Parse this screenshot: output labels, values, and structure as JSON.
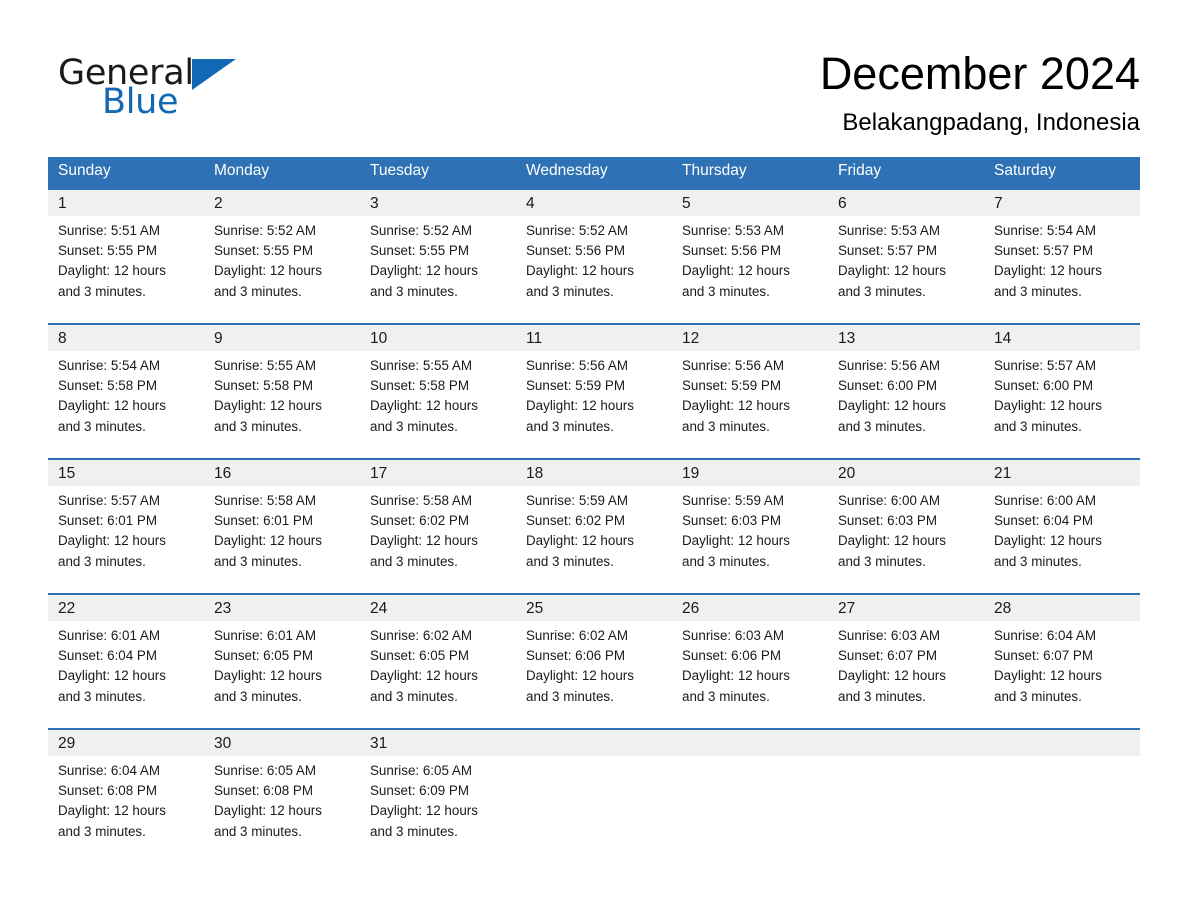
{
  "brand": {
    "name_part1": "General",
    "name_part2": "Blue",
    "triangle_icon": "blue-triangle-logo-mark",
    "accent_color": "#1268b3"
  },
  "header": {
    "title": "December 2024",
    "subtitle": "Belakangpadang, Indonesia"
  },
  "theme": {
    "header_blue": "#2E71B4",
    "daynum_band": "#f0f0f0",
    "text": "#1a1a1a"
  },
  "calendar": {
    "day_headers": [
      "Sunday",
      "Monday",
      "Tuesday",
      "Wednesday",
      "Thursday",
      "Friday",
      "Saturday"
    ],
    "weeks": [
      {
        "days": [
          {
            "num": "1",
            "sunrise": "Sunrise: 5:51 AM",
            "sunset": "Sunset: 5:55 PM",
            "daylight1": "Daylight: 12 hours",
            "daylight2": "and 3 minutes."
          },
          {
            "num": "2",
            "sunrise": "Sunrise: 5:52 AM",
            "sunset": "Sunset: 5:55 PM",
            "daylight1": "Daylight: 12 hours",
            "daylight2": "and 3 minutes."
          },
          {
            "num": "3",
            "sunrise": "Sunrise: 5:52 AM",
            "sunset": "Sunset: 5:55 PM",
            "daylight1": "Daylight: 12 hours",
            "daylight2": "and 3 minutes."
          },
          {
            "num": "4",
            "sunrise": "Sunrise: 5:52 AM",
            "sunset": "Sunset: 5:56 PM",
            "daylight1": "Daylight: 12 hours",
            "daylight2": "and 3 minutes."
          },
          {
            "num": "5",
            "sunrise": "Sunrise: 5:53 AM",
            "sunset": "Sunset: 5:56 PM",
            "daylight1": "Daylight: 12 hours",
            "daylight2": "and 3 minutes."
          },
          {
            "num": "6",
            "sunrise": "Sunrise: 5:53 AM",
            "sunset": "Sunset: 5:57 PM",
            "daylight1": "Daylight: 12 hours",
            "daylight2": "and 3 minutes."
          },
          {
            "num": "7",
            "sunrise": "Sunrise: 5:54 AM",
            "sunset": "Sunset: 5:57 PM",
            "daylight1": "Daylight: 12 hours",
            "daylight2": "and 3 minutes."
          }
        ]
      },
      {
        "days": [
          {
            "num": "8",
            "sunrise": "Sunrise: 5:54 AM",
            "sunset": "Sunset: 5:58 PM",
            "daylight1": "Daylight: 12 hours",
            "daylight2": "and 3 minutes."
          },
          {
            "num": "9",
            "sunrise": "Sunrise: 5:55 AM",
            "sunset": "Sunset: 5:58 PM",
            "daylight1": "Daylight: 12 hours",
            "daylight2": "and 3 minutes."
          },
          {
            "num": "10",
            "sunrise": "Sunrise: 5:55 AM",
            "sunset": "Sunset: 5:58 PM",
            "daylight1": "Daylight: 12 hours",
            "daylight2": "and 3 minutes."
          },
          {
            "num": "11",
            "sunrise": "Sunrise: 5:56 AM",
            "sunset": "Sunset: 5:59 PM",
            "daylight1": "Daylight: 12 hours",
            "daylight2": "and 3 minutes."
          },
          {
            "num": "12",
            "sunrise": "Sunrise: 5:56 AM",
            "sunset": "Sunset: 5:59 PM",
            "daylight1": "Daylight: 12 hours",
            "daylight2": "and 3 minutes."
          },
          {
            "num": "13",
            "sunrise": "Sunrise: 5:56 AM",
            "sunset": "Sunset: 6:00 PM",
            "daylight1": "Daylight: 12 hours",
            "daylight2": "and 3 minutes."
          },
          {
            "num": "14",
            "sunrise": "Sunrise: 5:57 AM",
            "sunset": "Sunset: 6:00 PM",
            "daylight1": "Daylight: 12 hours",
            "daylight2": "and 3 minutes."
          }
        ]
      },
      {
        "days": [
          {
            "num": "15",
            "sunrise": "Sunrise: 5:57 AM",
            "sunset": "Sunset: 6:01 PM",
            "daylight1": "Daylight: 12 hours",
            "daylight2": "and 3 minutes."
          },
          {
            "num": "16",
            "sunrise": "Sunrise: 5:58 AM",
            "sunset": "Sunset: 6:01 PM",
            "daylight1": "Daylight: 12 hours",
            "daylight2": "and 3 minutes."
          },
          {
            "num": "17",
            "sunrise": "Sunrise: 5:58 AM",
            "sunset": "Sunset: 6:02 PM",
            "daylight1": "Daylight: 12 hours",
            "daylight2": "and 3 minutes."
          },
          {
            "num": "18",
            "sunrise": "Sunrise: 5:59 AM",
            "sunset": "Sunset: 6:02 PM",
            "daylight1": "Daylight: 12 hours",
            "daylight2": "and 3 minutes."
          },
          {
            "num": "19",
            "sunrise": "Sunrise: 5:59 AM",
            "sunset": "Sunset: 6:03 PM",
            "daylight1": "Daylight: 12 hours",
            "daylight2": "and 3 minutes."
          },
          {
            "num": "20",
            "sunrise": "Sunrise: 6:00 AM",
            "sunset": "Sunset: 6:03 PM",
            "daylight1": "Daylight: 12 hours",
            "daylight2": "and 3 minutes."
          },
          {
            "num": "21",
            "sunrise": "Sunrise: 6:00 AM",
            "sunset": "Sunset: 6:04 PM",
            "daylight1": "Daylight: 12 hours",
            "daylight2": "and 3 minutes."
          }
        ]
      },
      {
        "days": [
          {
            "num": "22",
            "sunrise": "Sunrise: 6:01 AM",
            "sunset": "Sunset: 6:04 PM",
            "daylight1": "Daylight: 12 hours",
            "daylight2": "and 3 minutes."
          },
          {
            "num": "23",
            "sunrise": "Sunrise: 6:01 AM",
            "sunset": "Sunset: 6:05 PM",
            "daylight1": "Daylight: 12 hours",
            "daylight2": "and 3 minutes."
          },
          {
            "num": "24",
            "sunrise": "Sunrise: 6:02 AM",
            "sunset": "Sunset: 6:05 PM",
            "daylight1": "Daylight: 12 hours",
            "daylight2": "and 3 minutes."
          },
          {
            "num": "25",
            "sunrise": "Sunrise: 6:02 AM",
            "sunset": "Sunset: 6:06 PM",
            "daylight1": "Daylight: 12 hours",
            "daylight2": "and 3 minutes."
          },
          {
            "num": "26",
            "sunrise": "Sunrise: 6:03 AM",
            "sunset": "Sunset: 6:06 PM",
            "daylight1": "Daylight: 12 hours",
            "daylight2": "and 3 minutes."
          },
          {
            "num": "27",
            "sunrise": "Sunrise: 6:03 AM",
            "sunset": "Sunset: 6:07 PM",
            "daylight1": "Daylight: 12 hours",
            "daylight2": "and 3 minutes."
          },
          {
            "num": "28",
            "sunrise": "Sunrise: 6:04 AM",
            "sunset": "Sunset: 6:07 PM",
            "daylight1": "Daylight: 12 hours",
            "daylight2": "and 3 minutes."
          }
        ]
      },
      {
        "days": [
          {
            "num": "29",
            "sunrise": "Sunrise: 6:04 AM",
            "sunset": "Sunset: 6:08 PM",
            "daylight1": "Daylight: 12 hours",
            "daylight2": "and 3 minutes."
          },
          {
            "num": "30",
            "sunrise": "Sunrise: 6:05 AM",
            "sunset": "Sunset: 6:08 PM",
            "daylight1": "Daylight: 12 hours",
            "daylight2": "and 3 minutes."
          },
          {
            "num": "31",
            "sunrise": "Sunrise: 6:05 AM",
            "sunset": "Sunset: 6:09 PM",
            "daylight1": "Daylight: 12 hours",
            "daylight2": "and 3 minutes."
          },
          {
            "num": "",
            "sunrise": "",
            "sunset": "",
            "daylight1": "",
            "daylight2": ""
          },
          {
            "num": "",
            "sunrise": "",
            "sunset": "",
            "daylight1": "",
            "daylight2": ""
          },
          {
            "num": "",
            "sunrise": "",
            "sunset": "",
            "daylight1": "",
            "daylight2": ""
          },
          {
            "num": "",
            "sunrise": "",
            "sunset": "",
            "daylight1": "",
            "daylight2": ""
          }
        ]
      }
    ]
  }
}
